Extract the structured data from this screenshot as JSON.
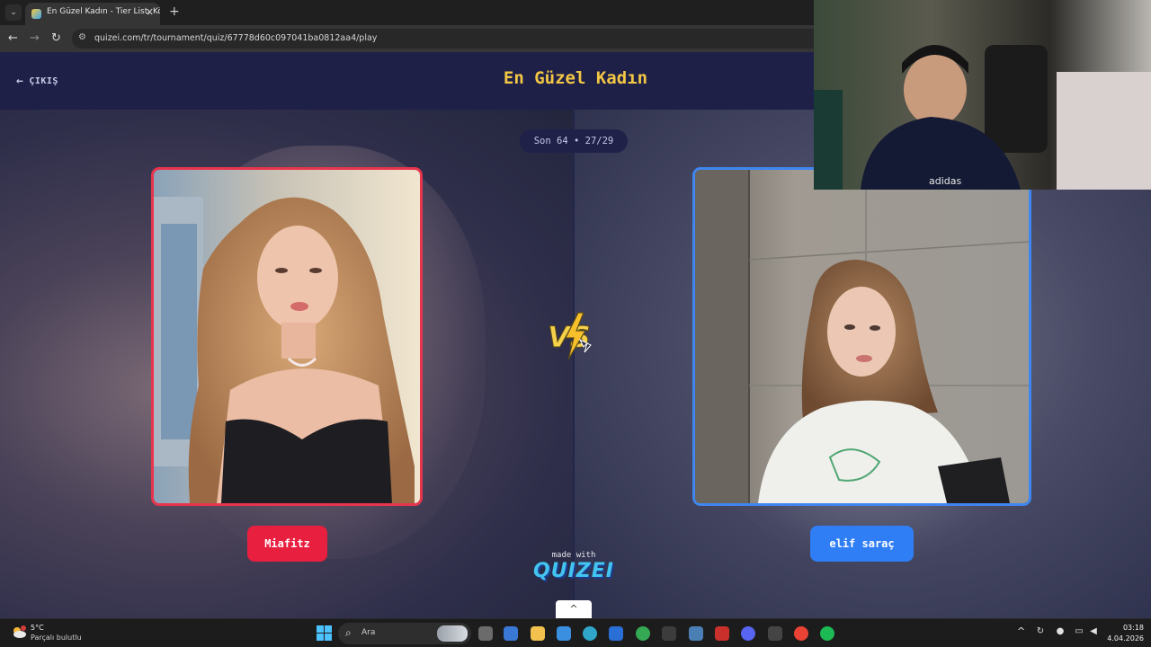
{
  "browser": {
    "tab_title": "En Güzel Kadın - Tier List, Kör S",
    "tab_close": "✕",
    "new_tab": "+",
    "tab_menu": "⌄",
    "url": "quizei.com/tr/tournament/quiz/67778d60c097041ba0812aa4/play",
    "back": "←",
    "forward": "→",
    "reload": "↻"
  },
  "header": {
    "exit_label": "ÇIKIŞ",
    "exit_arrow": "←",
    "title": "En Güzel Kadın"
  },
  "round": {
    "label": "Son 64 • 27/29"
  },
  "contestants": {
    "left": {
      "name": "Miafitz",
      "border_color": "#e8354d"
    },
    "right": {
      "name": "elif saraç",
      "border_color": "#3f86ef"
    }
  },
  "versus": {
    "text": "VS"
  },
  "branding": {
    "made_with": "made with",
    "logo": "QUIZEI"
  },
  "collapse": {
    "icon": "^"
  },
  "taskbar": {
    "weather_temp": "5°C",
    "weather_desc": "Parçalı bulutlu",
    "search_placeholder": "Ara",
    "search_icon": "⌕",
    "tray_up": "^",
    "time": "03:18",
    "date": "4.04.2026"
  },
  "colors": {
    "accent_title": "#f3c744",
    "header_bg": "#1f2048",
    "left_button": "#e81f3f",
    "right_button": "#2f7ef6"
  }
}
